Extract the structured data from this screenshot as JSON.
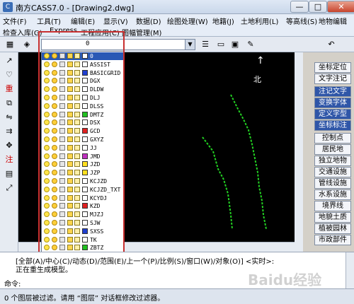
{
  "window": {
    "title": "南方CASS7.0 - [Drawing2.dwg]",
    "app_icon_text": "C",
    "controls": {
      "minimize": "—",
      "maximize": "□",
      "close": "✕"
    }
  },
  "menu_row1": [
    "文件(F)",
    "工具(T)",
    "编辑(E)",
    "显示(V)",
    "数据(D)",
    "绘图处理(W)",
    "地籍(J)",
    "土地利用(L)",
    "等高线(S)",
    "地物编辑"
  ],
  "menu_row2": [
    "检查入库(G)",
    "Express",
    "工程应用(C)",
    "图幅管理(M)"
  ],
  "layer_combo": {
    "value": "0"
  },
  "layers": [
    {
      "name": "0",
      "color": "#ffffff",
      "selected": true
    },
    {
      "name": "ASSIST",
      "color": "#ffffff"
    },
    {
      "name": "BASICGRID",
      "color": "#1f3fd0"
    },
    {
      "name": "DGX",
      "color": "#ffffff"
    },
    {
      "name": "DLDW",
      "color": "#ffffff"
    },
    {
      "name": "DLJ",
      "color": "#ffffff"
    },
    {
      "name": "DLSS",
      "color": "#ffffff"
    },
    {
      "name": "DMTZ",
      "color": "#20c020"
    },
    {
      "name": "DSX",
      "color": "#ffffff"
    },
    {
      "name": "GCD",
      "color": "#e02020"
    },
    {
      "name": "GXYZ",
      "color": "#ffffff"
    },
    {
      "name": "JJ",
      "color": "#ffffff"
    },
    {
      "name": "JMD",
      "color": "#c030c0"
    },
    {
      "name": "JZD",
      "color": "#ffe020"
    },
    {
      "name": "JZP",
      "color": "#ffe020"
    },
    {
      "name": "KCJZD",
      "color": "#ffffff"
    },
    {
      "name": "KCJZD_TXT",
      "color": "#ffffff"
    },
    {
      "name": "KCYDJ",
      "color": "#ffffff"
    },
    {
      "name": "KZD",
      "color": "#e02020"
    },
    {
      "name": "MJZJ",
      "color": "#ffffff"
    },
    {
      "name": "SJW",
      "color": "#ffffff"
    },
    {
      "name": "SXSS",
      "color": "#1f3fd0"
    },
    {
      "name": "TK",
      "color": "#ffffff"
    },
    {
      "name": "ZBTZ",
      "color": "#20c020"
    },
    {
      "name": "ZDH",
      "color": "#ffffff"
    },
    {
      "name": "ZJ",
      "color": "#ffffff"
    }
  ],
  "right_panel": {
    "buttons": [
      "坐标定位",
      "文字注记",
      "注记文字",
      "变换字体",
      "定义字型",
      "坐标标注",
      "控制点",
      "居民地",
      "独立地物",
      "交通设施",
      "管线设施",
      "水系设施",
      "境界线",
      "地貌土质",
      "植被园林",
      "市政部件"
    ],
    "blue_buttons": [
      "注记文字",
      "变换字体",
      "定义字型",
      "坐标标注"
    ]
  },
  "canvas": {
    "north_label": "北",
    "north_arrow": "↑"
  },
  "command": {
    "line1": "[全部(A)/中心(C)/动态(D)/范围(E)/上一个(P)/比例(S)/窗口(W)/对象(O)] <实时>:",
    "line2": "正在重生成模型。",
    "prompt": "命令:"
  },
  "status": {
    "text": "0 个图层被过滤。请用 “图层” 对话框修改过滤器。"
  },
  "watermark": "Baidu经验",
  "icons": {
    "toolbar": [
      "layer-manager-icon",
      "layer-state-icon",
      "line-type-icon",
      "save-icon",
      "open-icon",
      "pencil-icon",
      "undo-icon"
    ],
    "left": [
      "arrow-icon",
      "heart-icon",
      "repeat-icon",
      "copy-icon",
      "mirror-icon",
      "offset-icon",
      "move-icon",
      "note-icon",
      "grid-icon",
      "scale-icon"
    ]
  },
  "colors": {
    "selection": "#2a59b5",
    "highlight_frame": "#c83030",
    "panel_blue": "#2f56a8"
  }
}
